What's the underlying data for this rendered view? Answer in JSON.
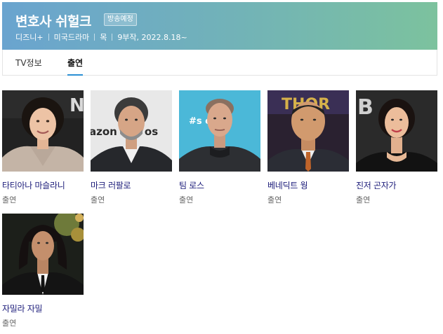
{
  "header": {
    "title": "변호사 쉬헐크",
    "badge": "방송예정",
    "meta": [
      "디즈니+",
      "미국드라마",
      "목",
      "9부작, 2022.8.18~"
    ]
  },
  "tabs": [
    {
      "label": "TV정보",
      "active": false
    },
    {
      "label": "출연",
      "active": true
    }
  ],
  "cast": [
    {
      "name": "타티아나 마슬라니",
      "role": "출연",
      "photo_text": "NO"
    },
    {
      "name": "마크 러팔로",
      "role": "출연",
      "photo_text": "azon Stu  os"
    },
    {
      "name": "팀 로스",
      "role": "출연",
      "photo_text": "#s         ce"
    },
    {
      "name": "베네딕트 웡",
      "role": "출연",
      "photo_text": "THOR"
    },
    {
      "name": "진저 곤자가",
      "role": "출연",
      "photo_text": "B"
    },
    {
      "name": "자밀라 자밀",
      "role": "출연",
      "photo_text": ""
    }
  ]
}
